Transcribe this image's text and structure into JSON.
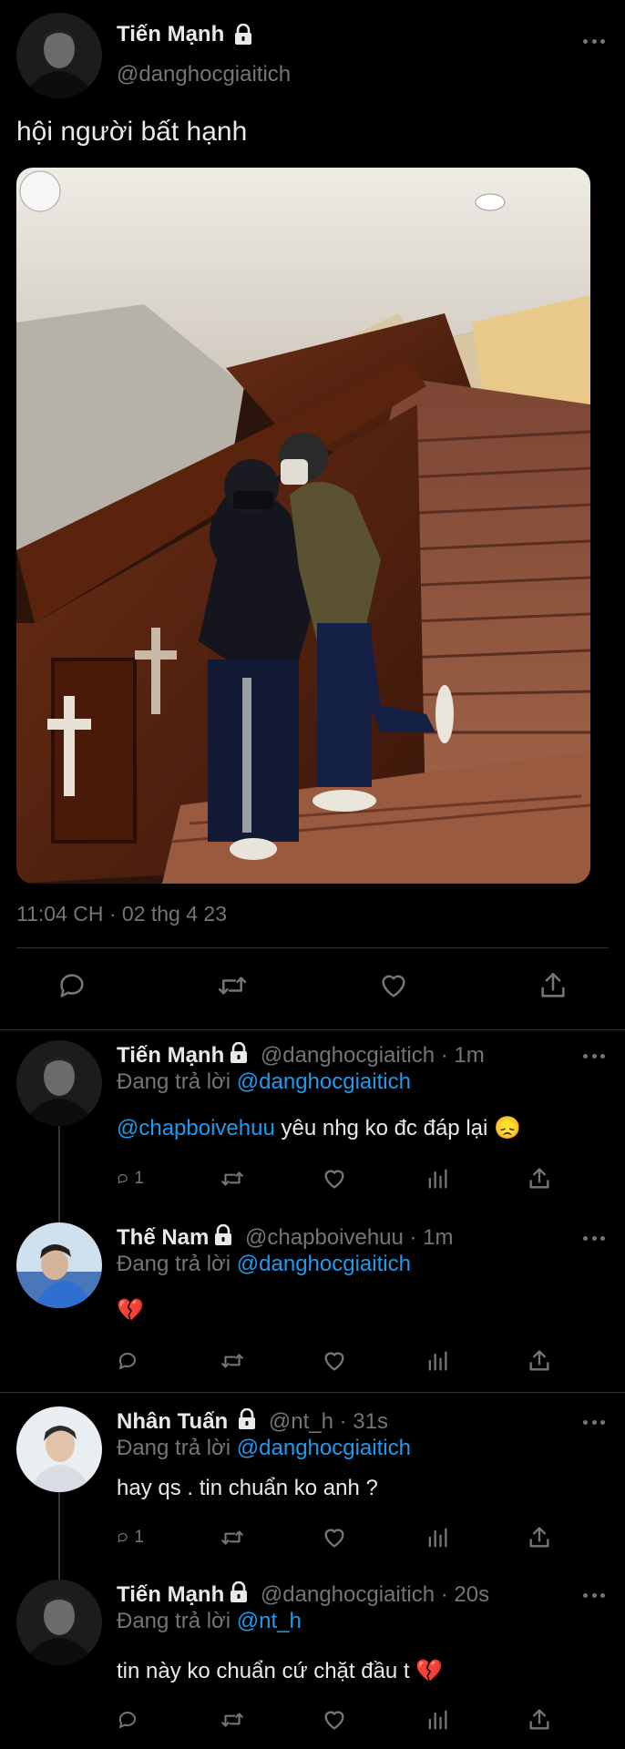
{
  "main_tweet": {
    "author_name": "Tiến Mạnh",
    "handle": "@danghocgiaitich",
    "text": "hội người bất hạnh",
    "timestamp": "11:04 CH · 02 thg 4 23",
    "photo_icon": "stairs-photo"
  },
  "replying_to_label": "Đang trả lời",
  "replies": [
    {
      "name": "Tiến Mạnh",
      "meta": "@danghocgiaitich · 1m",
      "replying_to": "@danghocgiaitich",
      "mention": "@chapboivehuu",
      "text": " yêu nhg ko đc đáp lại 😞",
      "reply_count": "1"
    },
    {
      "name": "Thế Nam",
      "meta": "@chapboivehuu · 1m",
      "replying_to": "@danghocgiaitich",
      "text": "💔",
      "reply_count": ""
    },
    {
      "name": "Nhân Tuấn",
      "meta": "@nt_h · 31s",
      "replying_to": "@danghocgiaitich",
      "text": "hay qs . tin chuẩn ko anh ?",
      "reply_count": "1"
    },
    {
      "name": "Tiến Mạnh",
      "meta": "@danghocgiaitich · 20s",
      "replying_to": "@nt_h",
      "text": "tin này ko chuẩn cứ chặt đầu t 💔",
      "reply_count": ""
    }
  ],
  "colors": {
    "accent": "#1d9bf0",
    "muted": "#71767b",
    "divider": "#2f3336",
    "background": "#000000"
  }
}
